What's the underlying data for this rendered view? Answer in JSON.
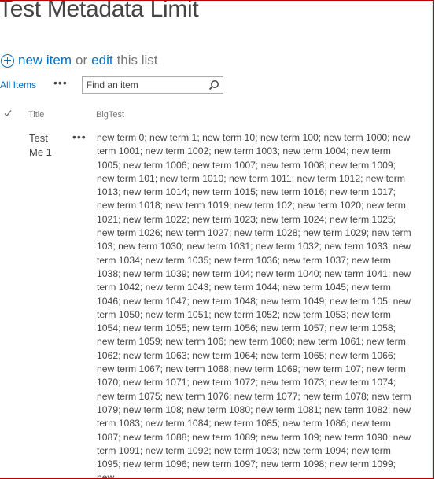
{
  "page": {
    "title": "Test Metadata Limit"
  },
  "actions": {
    "new_item": "new item",
    "or": "or",
    "edit": "edit",
    "this_list": "this list"
  },
  "views": {
    "all_items": "All Items",
    "more": "•••"
  },
  "search": {
    "placeholder": "Find an item"
  },
  "columns": {
    "title": "Title",
    "bigtest": "BigTest"
  },
  "row": {
    "title": "Test Me 1",
    "menu": "•••",
    "bigtest": "new term 0; new term 1; new term 10; new term 100; new term 1000; new term 1001; new term 1002; new term 1003; new term 1004; new term 1005; new term 1006; new term 1007; new term 1008; new term 1009; new term 101; new term 1010; new term 1011; new term 1012; new term 1013; new term 1014; new term 1015; new term 1016; new term 1017; new term 1018; new term 1019; new term 102; new term 1020; new term 1021; new term 1022; new term 1023; new term 1024; new term 1025; new term 1026; new term 1027; new term 1028; new term 1029; new term 103; new term 1030; new term 1031; new term 1032; new term 1033; new term 1034; new term 1035; new term 1036; new term 1037; new term 1038; new term 1039; new term 104; new term 1040; new term 1041; new term 1042; new term 1043; new term 1044; new term 1045; new term 1046; new term 1047; new term 1048; new term 1049; new term 105; new term 1050; new term 1051; new term 1052; new term 1053; new term 1054; new term 1055; new term 1056; new term 1057; new term 1058; new term 1059; new term 106; new term 1060; new term 1061; new term 1062; new term 1063; new term 1064; new term 1065; new term 1066; new term 1067; new term 1068; new term 1069; new term 107; new term 1070; new term 1071; new term 1072; new term 1073; new term 1074; new term 1075; new term 1076; new term 1077; new term 1078; new term 1079; new term 108; new term 1080; new term 1081; new term 1082; new term 1083; new term 1084; new term 1085; new term 1086; new term 1087; new term 1088; new term 1089; new term 109; new term 1090; new term 1091; new term 1092; new term 1093; new term 1094; new term 1095; new term 1096; new term 1097; new term 1098; new term 1099; new"
  },
  "colors": {
    "accent": "#0072c6",
    "text": "#444444",
    "muted": "#777777",
    "frame_border": "#c00000"
  },
  "icons": {
    "new": "plus-circle-icon",
    "search": "search-icon",
    "select_all": "checkmark-icon"
  }
}
